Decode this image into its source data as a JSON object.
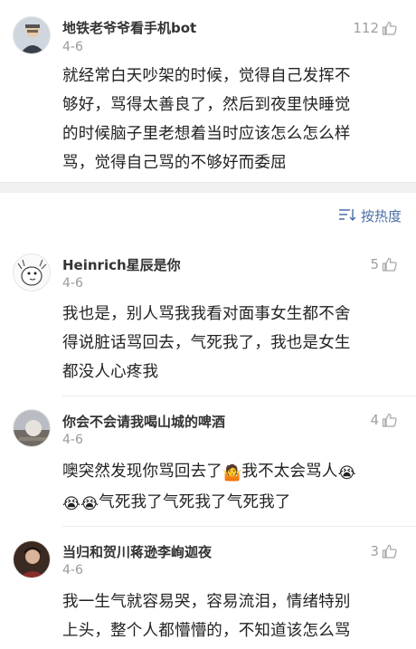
{
  "comments": [
    {
      "username": "地铁老爷爷看手机bot",
      "date": "4-6",
      "likes": "112",
      "lines": [
        "就经常白天吵架的时候，觉得自己发挥不",
        "够好，骂得太善良了，然后到夜里快睡觉",
        "的时候脑子里老想着当时应该怎么怎么样",
        "骂，觉得自己骂的不够好而委屈"
      ]
    },
    {
      "username": "Heinrich星辰是你",
      "date": "4-6",
      "likes": "5",
      "lines": [
        "我也是，别人骂我我看对面事女生都不舍",
        "得说脏话骂回去，气死我了，我也是女生",
        "都没人心疼我"
      ]
    },
    {
      "username": "你会不会请我喝山城的啤酒",
      "date": "4-6",
      "likes": "4",
      "line1_a": "噢突然发现你骂回去了",
      "line1_b": "我不太会骂人",
      "line2": "气死我了气死我了气死我了",
      "emoji_shrug": "🤷",
      "emoji_cry": "😭"
    },
    {
      "username": "当归和贺川蒋逊李峋迦夜",
      "date": "4-6",
      "likes": "3",
      "lines": [
        "我一生气就容易哭，容易流泪，情绪特别",
        "上头，整个人都懵懵的，不知道该怎么骂"
      ]
    }
  ],
  "sort": {
    "label": "按热度",
    "icon": "sort-icon"
  },
  "colors": {
    "link": "#4a6fa5",
    "meta": "#9a9a9a",
    "divider": "#f0f0f0"
  }
}
